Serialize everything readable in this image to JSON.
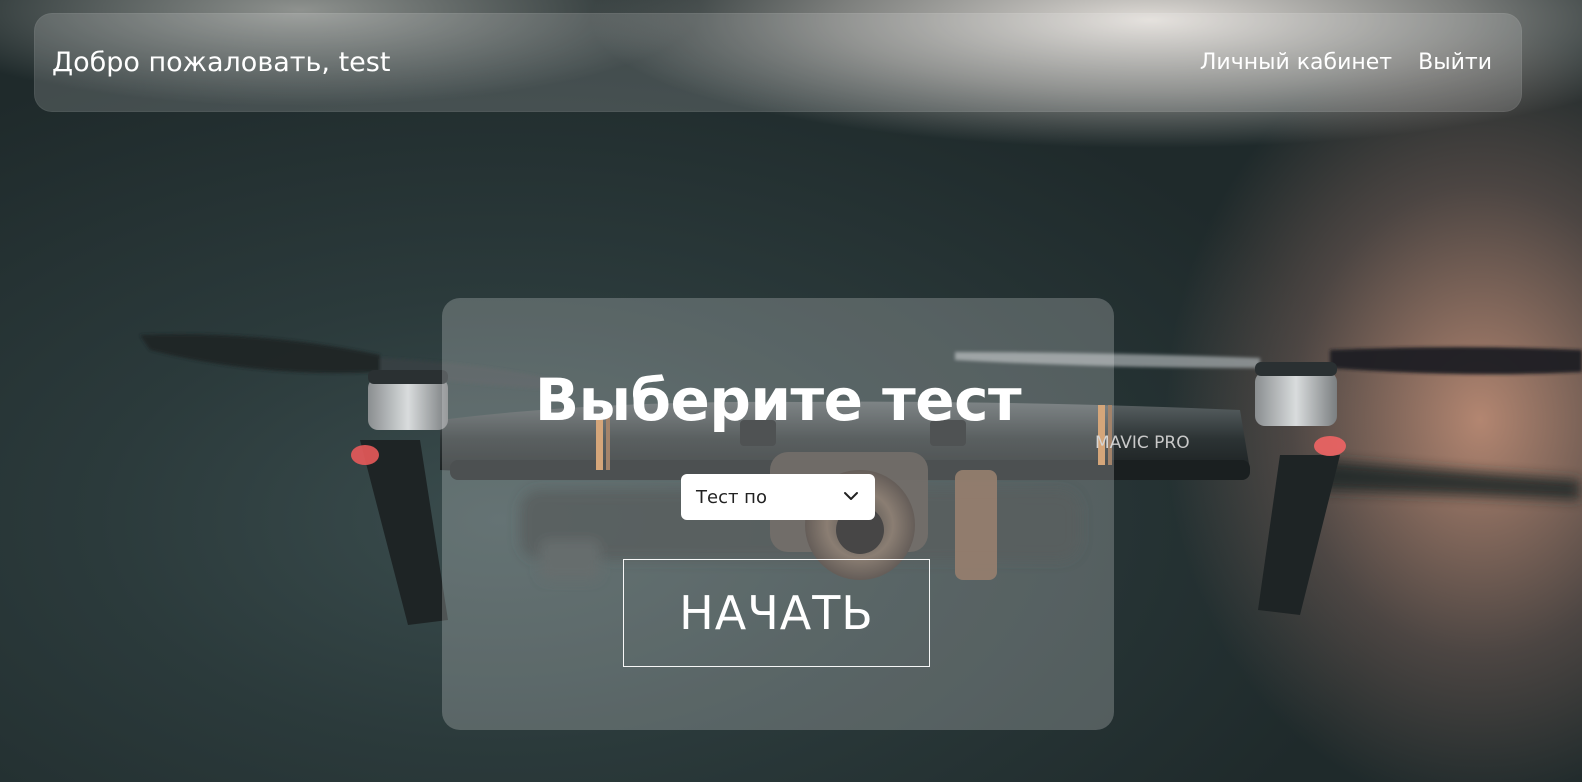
{
  "navbar": {
    "welcome_text": "Добро пожаловать, test",
    "links": [
      {
        "label": "Личный кабинет"
      },
      {
        "label": "Выйти"
      }
    ]
  },
  "main": {
    "title": "Выберите тест",
    "test_select": {
      "selected_value": "Тест по",
      "icon": "chevron-down-icon"
    },
    "start_button_label": "НАЧАТЬ"
  },
  "background": {
    "image_description_label": "MAVIC PRO",
    "colors": {
      "dark_teal": "#243031",
      "peach_glow": "#cd967d"
    }
  }
}
